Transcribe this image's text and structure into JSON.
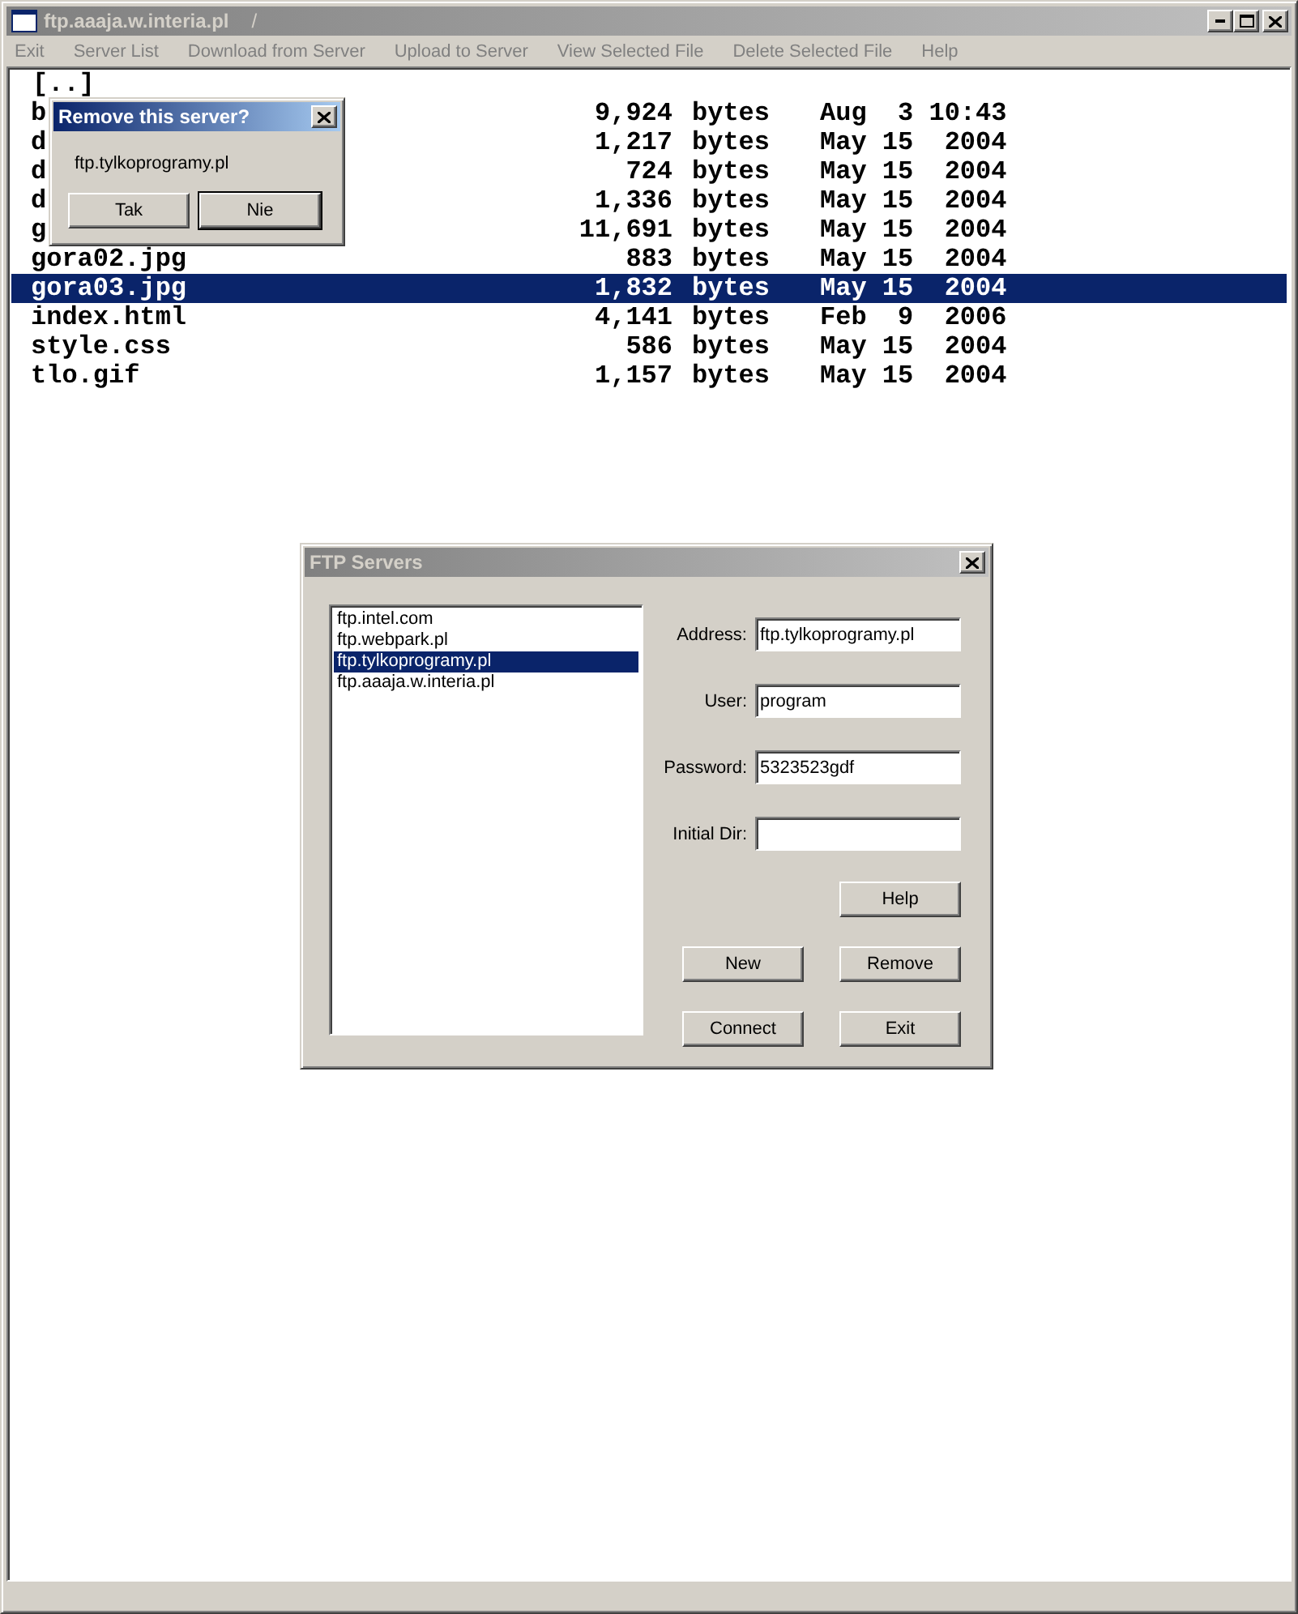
{
  "window": {
    "title": "ftp.aaaja.w.interia.pl",
    "path": "/",
    "active": false
  },
  "menu": [
    {
      "label": "Exit"
    },
    {
      "label": "Server List"
    },
    {
      "label": "Download from Server"
    },
    {
      "label": "Upload to Server"
    },
    {
      "label": "View Selected File"
    },
    {
      "label": "Delete Selected File"
    },
    {
      "label": "Help"
    }
  ],
  "files": {
    "parent": "[..]",
    "rows": [
      {
        "name": "b",
        "size": "9,924",
        "unit": "bytes",
        "date": "Aug  3 10:43",
        "selected": false
      },
      {
        "name": "d",
        "size": "1,217",
        "unit": "bytes",
        "date": "May 15  2004",
        "selected": false
      },
      {
        "name": "d",
        "size": "724",
        "unit": "bytes",
        "date": "May 15  2004",
        "selected": false
      },
      {
        "name": "d",
        "size": "1,336",
        "unit": "bytes",
        "date": "May 15  2004",
        "selected": false
      },
      {
        "name": "g",
        "size": "11,691",
        "unit": "bytes",
        "date": "May 15  2004",
        "selected": false
      },
      {
        "name": "gora02.jpg",
        "size": "883",
        "unit": "bytes",
        "date": "May 15  2004",
        "selected": false
      },
      {
        "name": "gora03.jpg",
        "size": "1,832",
        "unit": "bytes",
        "date": "May 15  2004",
        "selected": true
      },
      {
        "name": "index.html",
        "size": "4,141",
        "unit": "bytes",
        "date": "Feb  9  2006",
        "selected": false
      },
      {
        "name": "style.css",
        "size": "586",
        "unit": "bytes",
        "date": "May 15  2004",
        "selected": false
      },
      {
        "name": "tlo.gif",
        "size": "1,157",
        "unit": "bytes",
        "date": "May 15  2004",
        "selected": false
      }
    ]
  },
  "confirm_dialog": {
    "title": "Remove this server?",
    "active": true,
    "message": "ftp.tylkoprogramy.pl",
    "buttons": [
      {
        "label": "Tak",
        "default": false
      },
      {
        "label": "Nie",
        "default": true
      }
    ]
  },
  "ftp_servers": {
    "title": "FTP Servers",
    "active": false,
    "servers": [
      {
        "label": "ftp.intel.com",
        "selected": false
      },
      {
        "label": "ftp.webpark.pl",
        "selected": false
      },
      {
        "label": "ftp.tylkoprogramy.pl",
        "selected": true
      },
      {
        "label": "ftp.aaaja.w.interia.pl",
        "selected": false
      }
    ],
    "fields": [
      {
        "label": "Address:",
        "value": "ftp.tylkoprogramy.pl"
      },
      {
        "label": "User:",
        "value": "program"
      },
      {
        "label": "Password:",
        "value": "5323523gdf"
      },
      {
        "label": "Initial Dir:"
      }
    ],
    "buttons": [
      {
        "label": "Help"
      },
      {
        "label": "New"
      },
      {
        "label": "Remove"
      },
      {
        "label": "Connect"
      },
      {
        "label": "Exit"
      }
    ]
  }
}
